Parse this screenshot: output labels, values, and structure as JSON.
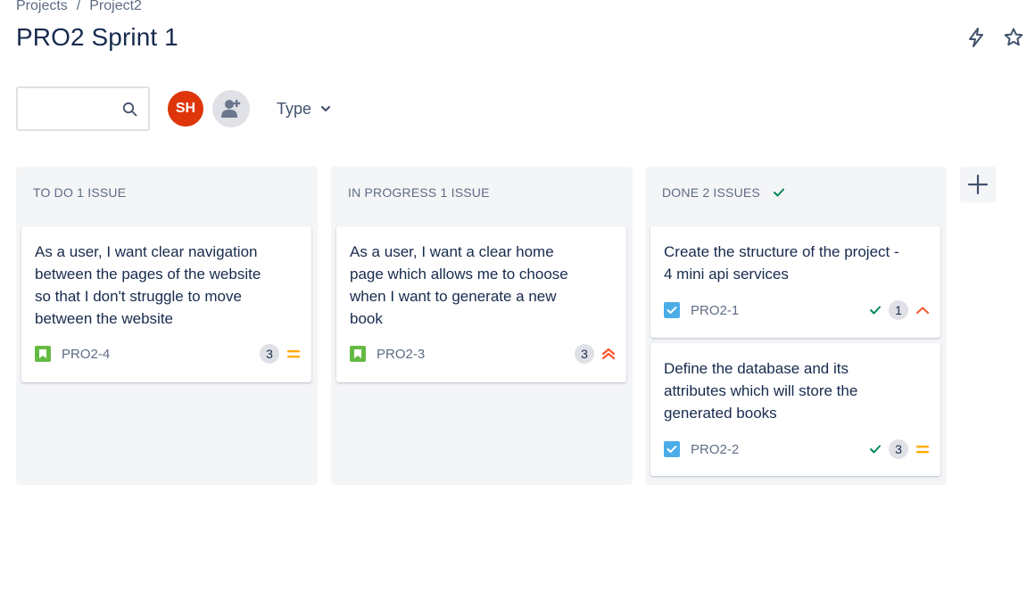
{
  "breadcrumb": {
    "projects": "Projects",
    "separator": "/",
    "project": "Project2"
  },
  "page": {
    "title": "PRO2 Sprint 1"
  },
  "top_actions": {
    "automation_icon": "lightning-icon",
    "star_icon": "star-icon"
  },
  "toolbar": {
    "search_placeholder": "",
    "search_icon": "search-icon",
    "avatar_initials": "SH",
    "avatar_color": "#de350b",
    "add_people_icon": "add-person-icon",
    "type_filter_label": "Type"
  },
  "columns": [
    {
      "title": "TO DO 1 ISSUE",
      "cards": [
        {
          "summary": "As a user, I want clear navigation between the pages of the website so that I don't struggle to move between the website",
          "key": "PRO2-4",
          "type": "story",
          "points": "3",
          "priority": "medium",
          "done": false
        }
      ]
    },
    {
      "title": "IN PROGRESS 1 ISSUE",
      "cards": [
        {
          "summary": "As a user, I want a clear home page which allows me to choose when I want to generate a new book",
          "key": "PRO2-3",
          "type": "story",
          "points": "3",
          "priority": "highest",
          "done": false
        }
      ]
    },
    {
      "title": "DONE 2 ISSUES",
      "cards": [
        {
          "summary": "Create the structure of the project - 4 mini api services",
          "key": "PRO2-1",
          "type": "task",
          "points": "1",
          "priority": "high",
          "done": true
        },
        {
          "summary": "Define the database and its attributes which will store the generated books",
          "key": "PRO2-2",
          "type": "task",
          "points": "3",
          "priority": "medium",
          "done": true
        }
      ]
    }
  ],
  "colors": {
    "story": "#65ba43",
    "task": "#4bade8",
    "done_check": "#00875a",
    "priority_medium": "#ffab00",
    "priority_high": "#f15c37",
    "priority_highest": "#ff5630"
  }
}
